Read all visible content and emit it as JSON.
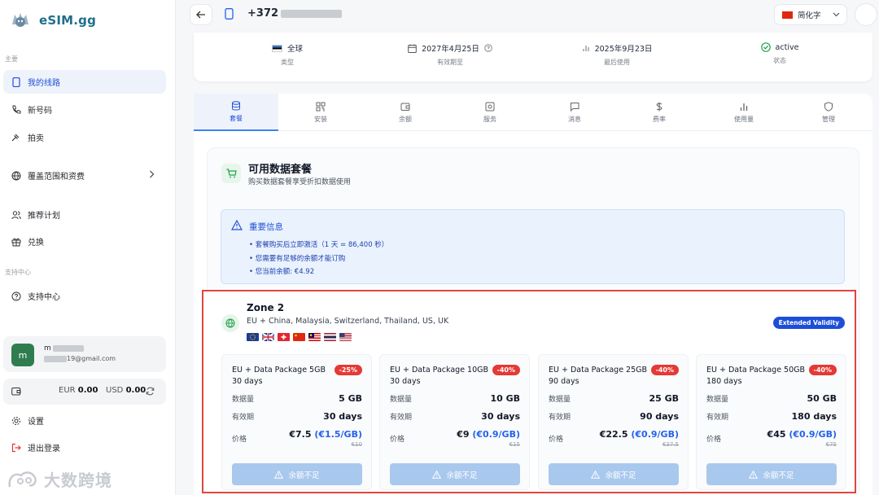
{
  "app": {
    "name": "eSIM.gg"
  },
  "sidebar": {
    "section_main": "主要",
    "section_support": "支持中心",
    "items": [
      {
        "label": "我的线路"
      },
      {
        "label": "新号码"
      },
      {
        "label": "拍卖"
      },
      {
        "label": "覆盖范围和资费"
      },
      {
        "label": "推荐计划"
      },
      {
        "label": "兑换"
      },
      {
        "label": "支持中心"
      },
      {
        "label": "设置"
      },
      {
        "label": "退出登录"
      }
    ],
    "user": {
      "initial": "m",
      "name": "m",
      "email": "19@gmail.com"
    },
    "balance": {
      "eur_label": "EUR",
      "eur": "0.00",
      "usd_label": "USD",
      "usd": "0.00"
    }
  },
  "header": {
    "phone": "+372",
    "language": "简化字"
  },
  "info": {
    "type_value": "全球",
    "type_label": "类型",
    "expiry_value": "2027年4月25日",
    "expiry_label": "有效期至",
    "last_used_value": "2025年9月23日",
    "last_used_label": "最后使用",
    "status_value": "active",
    "status_label": "状态"
  },
  "tabs": [
    {
      "label": "套餐"
    },
    {
      "label": "安装"
    },
    {
      "label": "余额"
    },
    {
      "label": "服务"
    },
    {
      "label": "消息"
    },
    {
      "label": "费率"
    },
    {
      "label": "使用量"
    },
    {
      "label": "管理"
    }
  ],
  "plans": {
    "title": "可用数据套餐",
    "subtitle": "购买数据套餐享受折扣数据使用"
  },
  "notice": {
    "title": "重要信息",
    "items": [
      "套餐购买后立即激活（1 天 = 86,400 秒）",
      "您需要有足够的余额才能订购",
      "您当前余额: €4.92"
    ]
  },
  "zone": {
    "title": "Zone 2",
    "countries": "EU + China, Malaysia, Switzerland, Thailand, US, UK",
    "badge": "Extended Validity",
    "labels": {
      "data": "数据量",
      "validity": "有效期",
      "price": "价格",
      "button": "余额不足"
    },
    "packages": [
      {
        "name": "EU + Data Package 5GB 30 days",
        "discount": "-25%",
        "data": "5 GB",
        "validity": "30 days",
        "price": "€7.5",
        "unit_price": "(€1.5/GB)",
        "old_price": "€10"
      },
      {
        "name": "EU + Data Package 10GB 30 days",
        "discount": "-40%",
        "data": "10 GB",
        "validity": "30 days",
        "price": "€9",
        "unit_price": "(€0.9/GB)",
        "old_price": "€15"
      },
      {
        "name": "EU + Data Package 25GB 90 days",
        "discount": "-40%",
        "data": "25 GB",
        "validity": "90 days",
        "price": "€22.5",
        "unit_price": "(€0.9/GB)",
        "old_price": "€37.5"
      },
      {
        "name": "EU + Data Package 50GB 180 days",
        "discount": "-40%",
        "data": "50 GB",
        "validity": "180 days",
        "price": "€45",
        "unit_price": "(€0.9/GB)",
        "old_price": "€75"
      }
    ]
  },
  "watermark": {
    "text": "大数跨境"
  },
  "colors": {
    "accent": "#1d4ed8",
    "highlight": "#e0463f",
    "discount": "#e53935",
    "button_disabled": "#a8c8ee"
  }
}
